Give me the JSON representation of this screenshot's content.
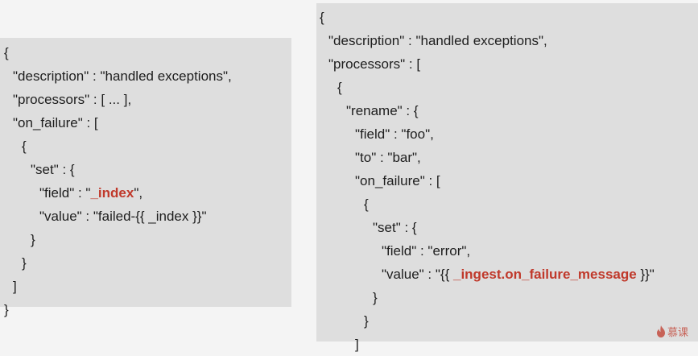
{
  "left_snippet": {
    "lines": [
      {
        "indent": 0,
        "parts": [
          {
            "text": "{"
          }
        ]
      },
      {
        "indent": 1,
        "parts": [
          {
            "text": "\"description\" : \"handled exceptions\","
          }
        ]
      },
      {
        "indent": 1,
        "parts": [
          {
            "text": "\"processors\" : [ ... ],"
          }
        ]
      },
      {
        "indent": 1,
        "parts": [
          {
            "text": "\"on_failure\" : ["
          }
        ]
      },
      {
        "indent": 2,
        "parts": [
          {
            "text": "{"
          }
        ]
      },
      {
        "indent": 3,
        "parts": [
          {
            "text": "\"set\" : {"
          }
        ]
      },
      {
        "indent": 4,
        "parts": [
          {
            "text": "\"field\" : \""
          },
          {
            "text": "_index",
            "highlight": true
          },
          {
            "text": "\","
          }
        ]
      },
      {
        "indent": 4,
        "parts": [
          {
            "text": "\"value\" : \"failed-{{ _index }}\""
          }
        ]
      },
      {
        "indent": 3,
        "parts": [
          {
            "text": "}"
          }
        ]
      },
      {
        "indent": 2,
        "parts": [
          {
            "text": "}"
          }
        ]
      },
      {
        "indent": 1,
        "parts": [
          {
            "text": "]"
          }
        ]
      },
      {
        "indent": 0,
        "parts": [
          {
            "text": "}"
          }
        ]
      }
    ]
  },
  "right_snippet": {
    "lines": [
      {
        "indent": 0,
        "parts": [
          {
            "text": "{"
          }
        ]
      },
      {
        "indent": 1,
        "parts": [
          {
            "text": "\"description\" : \"handled exceptions\","
          }
        ]
      },
      {
        "indent": 1,
        "parts": [
          {
            "text": "\"processors\" : ["
          }
        ]
      },
      {
        "indent": 2,
        "parts": [
          {
            "text": "{"
          }
        ]
      },
      {
        "indent": 3,
        "parts": [
          {
            "text": "\"rename\" : {"
          }
        ]
      },
      {
        "indent": 4,
        "parts": [
          {
            "text": "\"field\" : \"foo\","
          }
        ]
      },
      {
        "indent": 4,
        "parts": [
          {
            "text": "\"to\" : \"bar\","
          }
        ]
      },
      {
        "indent": 4,
        "parts": [
          {
            "text": "\"on_failure\" : ["
          }
        ]
      },
      {
        "indent": 5,
        "parts": [
          {
            "text": "{"
          }
        ]
      },
      {
        "indent": 6,
        "parts": [
          {
            "text": "\"set\" : {"
          }
        ]
      },
      {
        "indent": 7,
        "parts": [
          {
            "text": "\"field\" : \"error\","
          }
        ]
      },
      {
        "indent": 7,
        "parts": [
          {
            "text": "\"value\" : \"{{ "
          },
          {
            "text": "_ingest.on_failure_message",
            "highlight": true
          },
          {
            "text": " }}\""
          }
        ]
      },
      {
        "indent": 6,
        "parts": [
          {
            "text": "}"
          }
        ]
      },
      {
        "indent": 5,
        "parts": [
          {
            "text": "}"
          }
        ]
      },
      {
        "indent": 4,
        "parts": [
          {
            "text": "]"
          }
        ]
      }
    ]
  },
  "watermark": {
    "text": "慕课",
    "icon": "flame-icon"
  },
  "colors": {
    "highlight": "#c0392b",
    "panel_background": "#dedede",
    "page_background": "#f4f4f4"
  }
}
